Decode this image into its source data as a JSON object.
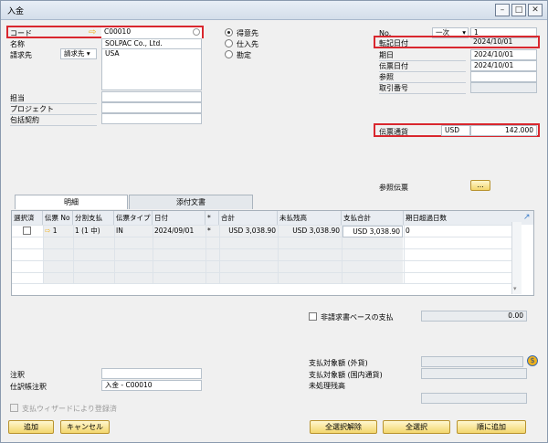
{
  "window": {
    "title": "入金"
  },
  "header": {
    "code_label": "コード",
    "code_value": "C00010",
    "name_label": "名称",
    "name_value": "SOLPAC Co., Ltd.",
    "billto_label": "請求先",
    "billto_select": "請求先",
    "billto_value": "USA",
    "owner_label": "担当",
    "project_label": "プロジェクト",
    "contract_label": "包括契約"
  },
  "radios": [
    {
      "label": "得意先",
      "selected": true
    },
    {
      "label": "仕入先",
      "selected": false
    },
    {
      "label": "勘定",
      "selected": false
    }
  ],
  "right": {
    "no_label": "No.",
    "series_value": "一次",
    "no_value": "1",
    "posting_label": "転記日付",
    "posting_value": "2024/10/01",
    "due_label": "期日",
    "due_value": "2024/10/01",
    "doc_label": "伝票日付",
    "doc_value": "2024/10/01",
    "ref_label": "参照",
    "txn_label": "取引番号",
    "currency_label": "伝票通貨",
    "currency_code": "USD",
    "currency_amount": "142.000",
    "refdoc_label": "参照伝票",
    "refdoc_button": "..."
  },
  "tabs": [
    "明細",
    "添付文書"
  ],
  "grid": {
    "headers": [
      "選択済",
      "伝票 No",
      "分割支払",
      "伝票タイプ",
      "日付",
      "*",
      "合計",
      "未払残高",
      "支払合計",
      "期日超過日数"
    ],
    "rows": [
      {
        "no": "1",
        "split": "1 (1 中)",
        "type": "IN",
        "date": "2024/09/01",
        "star": "*",
        "total": "USD 3,038.90",
        "open": "USD 3,038.90",
        "pay": "USD 3,038.90",
        "overdue": "0"
      }
    ]
  },
  "nonbase": {
    "label": "非請求書ベースの支払",
    "value": "0.00"
  },
  "bottom": {
    "remarks_label": "注釈",
    "journal_label": "仕訳帳注釈",
    "journal_value": "入金 - C00010",
    "amount_fc_label": "支払対象額 (外貨)",
    "amount_lc_label": "支払対象額 (国内通貨)",
    "open_label": "未処理残高",
    "wizard_label": "支払ウィザードにより登録済"
  },
  "buttons": {
    "add": "追加",
    "cancel": "キャンセル",
    "deselect_all": "全選択解除",
    "select_all": "全選択",
    "add_sequential": "順に追加"
  },
  "colors": {
    "highlight": "#d9272e",
    "button": "#f3d66c",
    "arrow": "#f0b21b"
  }
}
